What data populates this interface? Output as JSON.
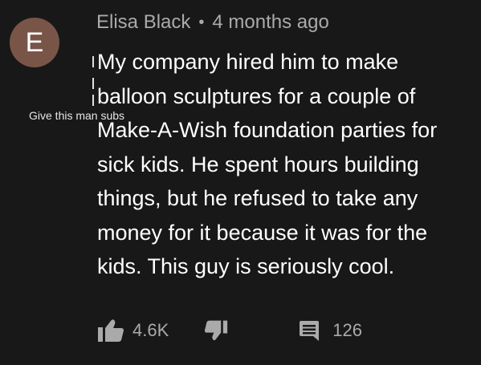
{
  "comment": {
    "avatar_letter": "E",
    "avatar_color": "#795548",
    "author": "Elisa Black",
    "separator": "•",
    "timestamp": "4 months ago",
    "overlay_label": "Give this man subs",
    "lines": [
      "My company hired him to make",
      "balloon sculptures for a couple of",
      "Make-A-Wish foundation parties for",
      "sick kids. He spent hours building",
      "things, but he refused to take any",
      "money for it because it was for the",
      "kids. This guy is seriously cool."
    ],
    "likes": "4.6K",
    "replies": "126",
    "icons": {
      "like": "thumbs-up-icon",
      "dislike": "thumbs-down-icon",
      "reply": "comment-icon"
    }
  }
}
